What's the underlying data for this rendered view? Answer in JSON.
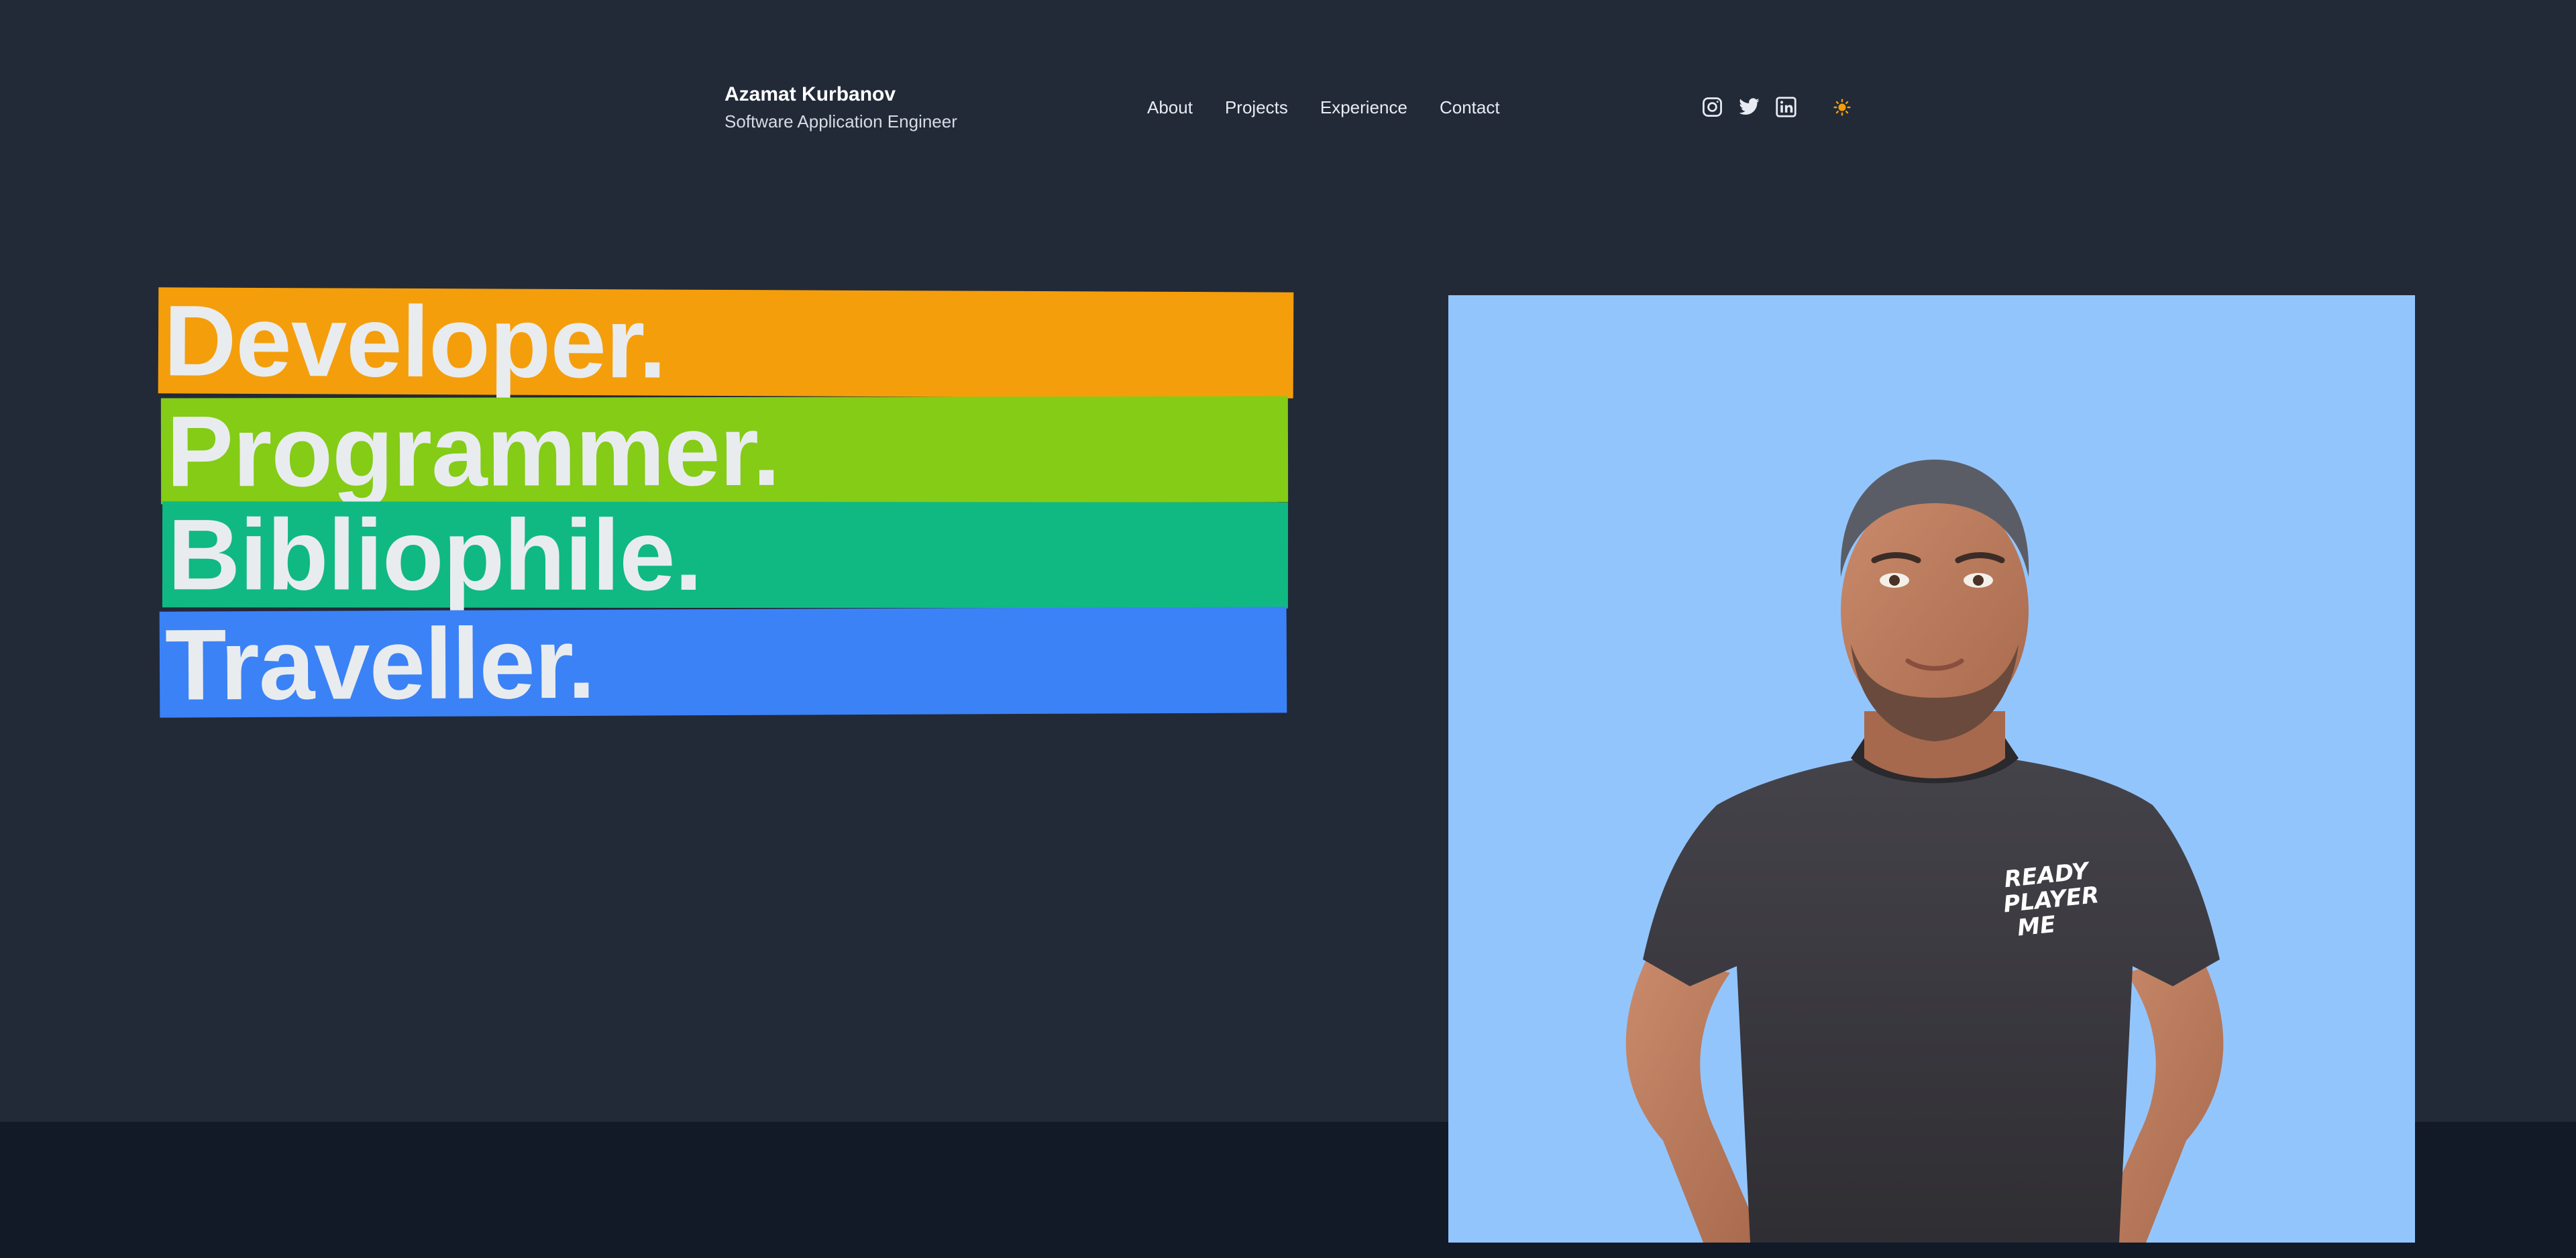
{
  "header": {
    "name": "Azamat Kurbanov",
    "title": "Software Application Engineer",
    "nav": [
      "About",
      "Projects",
      "Experience",
      "Contact"
    ],
    "social_icons": [
      "instagram-icon",
      "twitter-icon",
      "linkedin-icon"
    ],
    "theme_icon": "sun-icon"
  },
  "hero": {
    "words": [
      "Developer.",
      "Programmer.",
      "Bibliophile.",
      "Traveller."
    ],
    "band_colors": [
      "#f59e0b",
      "#84cc16",
      "#10b981",
      "#3b82f6"
    ]
  },
  "avatar": {
    "shirt_text": "READY PLAYER ME",
    "shirt_lines": [
      "READY",
      "PLAYER",
      "ME"
    ],
    "background": "#93c5fd"
  },
  "colors": {
    "page_bg": "#222a38",
    "footer_bg": "#131a27",
    "theme_icon": "#f59e0b"
  }
}
